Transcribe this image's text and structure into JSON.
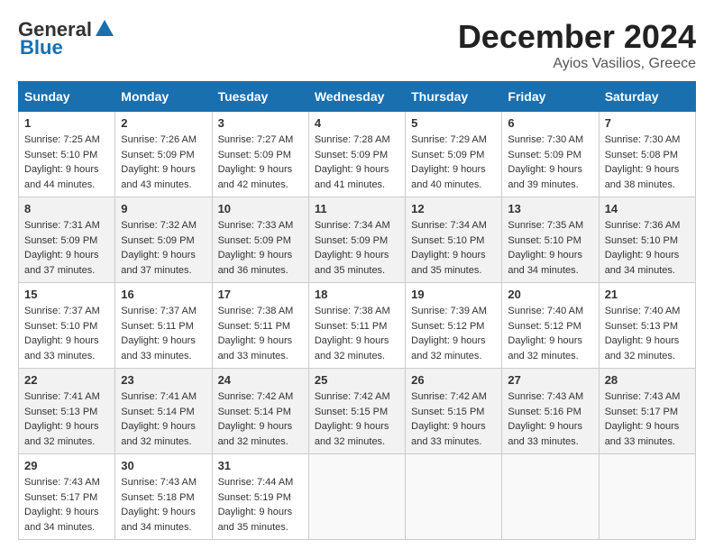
{
  "header": {
    "logo_general": "General",
    "logo_blue": "Blue",
    "month_title": "December 2024",
    "location": "Ayios Vasilios, Greece"
  },
  "calendar": {
    "days_of_week": [
      "Sunday",
      "Monday",
      "Tuesday",
      "Wednesday",
      "Thursday",
      "Friday",
      "Saturday"
    ],
    "weeks": [
      [
        {
          "day": "1",
          "sunrise": "Sunrise: 7:25 AM",
          "sunset": "Sunset: 5:10 PM",
          "daylight": "Daylight: 9 hours and 44 minutes."
        },
        {
          "day": "2",
          "sunrise": "Sunrise: 7:26 AM",
          "sunset": "Sunset: 5:09 PM",
          "daylight": "Daylight: 9 hours and 43 minutes."
        },
        {
          "day": "3",
          "sunrise": "Sunrise: 7:27 AM",
          "sunset": "Sunset: 5:09 PM",
          "daylight": "Daylight: 9 hours and 42 minutes."
        },
        {
          "day": "4",
          "sunrise": "Sunrise: 7:28 AM",
          "sunset": "Sunset: 5:09 PM",
          "daylight": "Daylight: 9 hours and 41 minutes."
        },
        {
          "day": "5",
          "sunrise": "Sunrise: 7:29 AM",
          "sunset": "Sunset: 5:09 PM",
          "daylight": "Daylight: 9 hours and 40 minutes."
        },
        {
          "day": "6",
          "sunrise": "Sunrise: 7:30 AM",
          "sunset": "Sunset: 5:09 PM",
          "daylight": "Daylight: 9 hours and 39 minutes."
        },
        {
          "day": "7",
          "sunrise": "Sunrise: 7:30 AM",
          "sunset": "Sunset: 5:08 PM",
          "daylight": "Daylight: 9 hours and 38 minutes."
        }
      ],
      [
        {
          "day": "8",
          "sunrise": "Sunrise: 7:31 AM",
          "sunset": "Sunset: 5:09 PM",
          "daylight": "Daylight: 9 hours and 37 minutes."
        },
        {
          "day": "9",
          "sunrise": "Sunrise: 7:32 AM",
          "sunset": "Sunset: 5:09 PM",
          "daylight": "Daylight: 9 hours and 37 minutes."
        },
        {
          "day": "10",
          "sunrise": "Sunrise: 7:33 AM",
          "sunset": "Sunset: 5:09 PM",
          "daylight": "Daylight: 9 hours and 36 minutes."
        },
        {
          "day": "11",
          "sunrise": "Sunrise: 7:34 AM",
          "sunset": "Sunset: 5:09 PM",
          "daylight": "Daylight: 9 hours and 35 minutes."
        },
        {
          "day": "12",
          "sunrise": "Sunrise: 7:34 AM",
          "sunset": "Sunset: 5:10 PM",
          "daylight": "Daylight: 9 hours and 35 minutes."
        },
        {
          "day": "13",
          "sunrise": "Sunrise: 7:35 AM",
          "sunset": "Sunset: 5:10 PM",
          "daylight": "Daylight: 9 hours and 34 minutes."
        },
        {
          "day": "14",
          "sunrise": "Sunrise: 7:36 AM",
          "sunset": "Sunset: 5:10 PM",
          "daylight": "Daylight: 9 hours and 34 minutes."
        }
      ],
      [
        {
          "day": "15",
          "sunrise": "Sunrise: 7:37 AM",
          "sunset": "Sunset: 5:10 PM",
          "daylight": "Daylight: 9 hours and 33 minutes."
        },
        {
          "day": "16",
          "sunrise": "Sunrise: 7:37 AM",
          "sunset": "Sunset: 5:11 PM",
          "daylight": "Daylight: 9 hours and 33 minutes."
        },
        {
          "day": "17",
          "sunrise": "Sunrise: 7:38 AM",
          "sunset": "Sunset: 5:11 PM",
          "daylight": "Daylight: 9 hours and 33 minutes."
        },
        {
          "day": "18",
          "sunrise": "Sunrise: 7:38 AM",
          "sunset": "Sunset: 5:11 PM",
          "daylight": "Daylight: 9 hours and 32 minutes."
        },
        {
          "day": "19",
          "sunrise": "Sunrise: 7:39 AM",
          "sunset": "Sunset: 5:12 PM",
          "daylight": "Daylight: 9 hours and 32 minutes."
        },
        {
          "day": "20",
          "sunrise": "Sunrise: 7:40 AM",
          "sunset": "Sunset: 5:12 PM",
          "daylight": "Daylight: 9 hours and 32 minutes."
        },
        {
          "day": "21",
          "sunrise": "Sunrise: 7:40 AM",
          "sunset": "Sunset: 5:13 PM",
          "daylight": "Daylight: 9 hours and 32 minutes."
        }
      ],
      [
        {
          "day": "22",
          "sunrise": "Sunrise: 7:41 AM",
          "sunset": "Sunset: 5:13 PM",
          "daylight": "Daylight: 9 hours and 32 minutes."
        },
        {
          "day": "23",
          "sunrise": "Sunrise: 7:41 AM",
          "sunset": "Sunset: 5:14 PM",
          "daylight": "Daylight: 9 hours and 32 minutes."
        },
        {
          "day": "24",
          "sunrise": "Sunrise: 7:42 AM",
          "sunset": "Sunset: 5:14 PM",
          "daylight": "Daylight: 9 hours and 32 minutes."
        },
        {
          "day": "25",
          "sunrise": "Sunrise: 7:42 AM",
          "sunset": "Sunset: 5:15 PM",
          "daylight": "Daylight: 9 hours and 32 minutes."
        },
        {
          "day": "26",
          "sunrise": "Sunrise: 7:42 AM",
          "sunset": "Sunset: 5:15 PM",
          "daylight": "Daylight: 9 hours and 33 minutes."
        },
        {
          "day": "27",
          "sunrise": "Sunrise: 7:43 AM",
          "sunset": "Sunset: 5:16 PM",
          "daylight": "Daylight: 9 hours and 33 minutes."
        },
        {
          "day": "28",
          "sunrise": "Sunrise: 7:43 AM",
          "sunset": "Sunset: 5:17 PM",
          "daylight": "Daylight: 9 hours and 33 minutes."
        }
      ],
      [
        {
          "day": "29",
          "sunrise": "Sunrise: 7:43 AM",
          "sunset": "Sunset: 5:17 PM",
          "daylight": "Daylight: 9 hours and 34 minutes."
        },
        {
          "day": "30",
          "sunrise": "Sunrise: 7:43 AM",
          "sunset": "Sunset: 5:18 PM",
          "daylight": "Daylight: 9 hours and 34 minutes."
        },
        {
          "day": "31",
          "sunrise": "Sunrise: 7:44 AM",
          "sunset": "Sunset: 5:19 PM",
          "daylight": "Daylight: 9 hours and 35 minutes."
        },
        null,
        null,
        null,
        null
      ]
    ]
  }
}
